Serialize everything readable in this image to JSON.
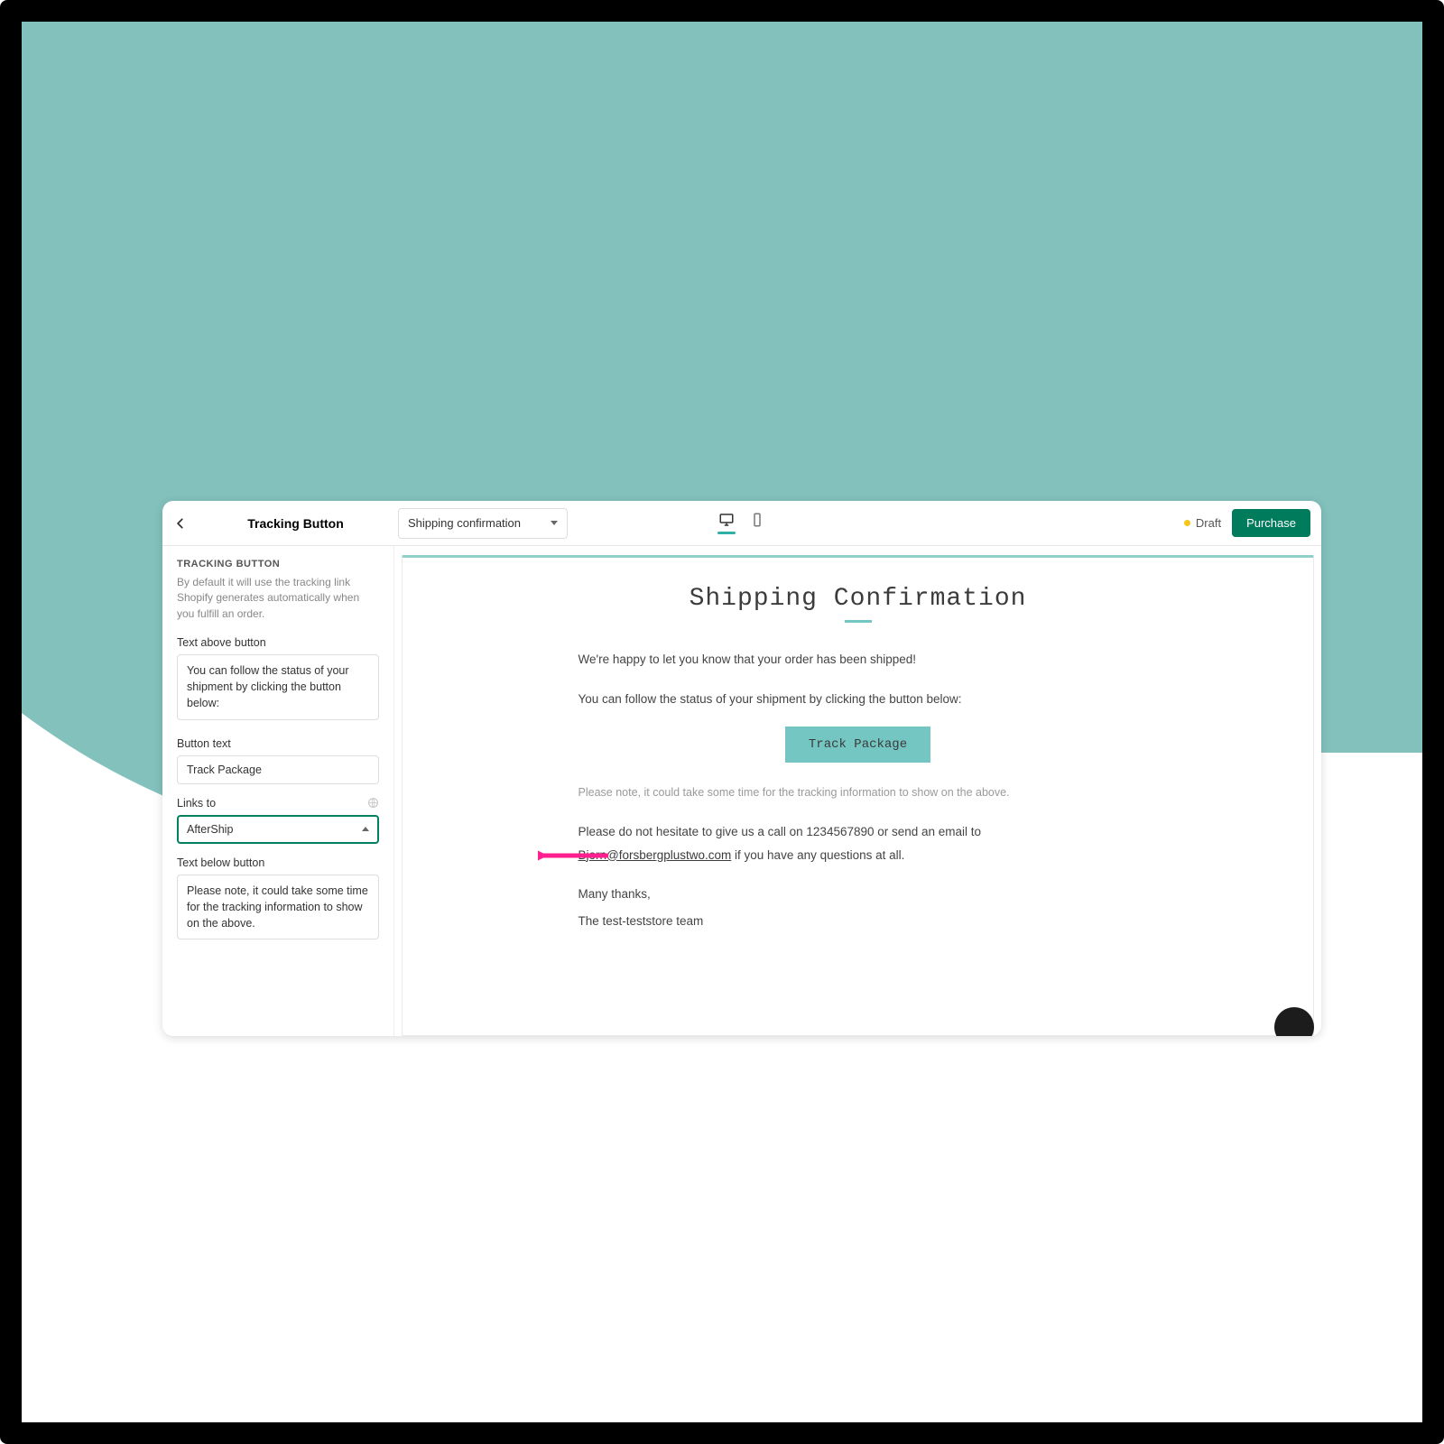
{
  "topbar": {
    "title": "Tracking Button",
    "template_select": "Shipping confirmation",
    "status": "Draft",
    "purchase": "Purchase"
  },
  "sidebar": {
    "section": "TRACKING BUTTON",
    "description": "By default it will use the tracking link Shopify generates automatically when you fulfill an order.",
    "text_above_label": "Text above button",
    "text_above_value": "You can follow the status of your shipment by clicking the button below:",
    "button_text_label": "Button text",
    "button_text_value": "Track Package",
    "links_to_label": "Links to",
    "links_to_value": "AfterShip",
    "text_below_label": "Text below button",
    "text_below_value": "Please note, it could take some time for the tracking information to show on the above."
  },
  "email": {
    "heading": "Shipping Confirmation",
    "p1": "We're happy to let you know that your order has been shipped!",
    "p2": "You can follow the status of your shipment by clicking the button below:",
    "button": "Track Package",
    "note": "Please note, it could take some time for the tracking information to show on the above.",
    "p3_a": "Please do not hesitate to give us a call on 1234567890 or send an email to ",
    "p3_link": "Bjorn@forsbergplustwo.com",
    "p3_b": " if you have any questions at all.",
    "thanks": "Many thanks,",
    "team": "The test-teststore team"
  }
}
